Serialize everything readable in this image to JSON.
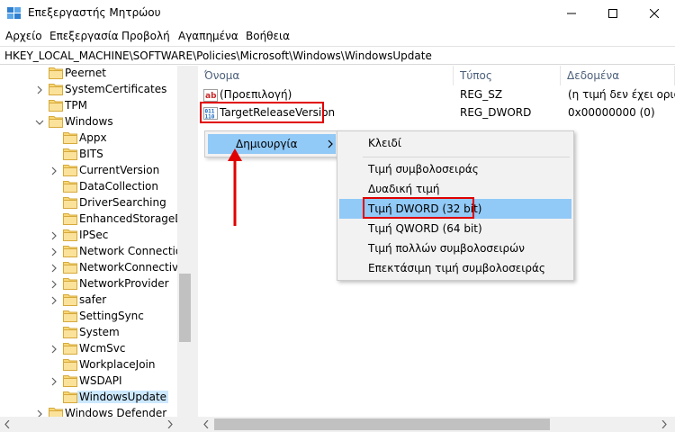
{
  "window": {
    "title": "Επεξεργαστής Μητρώου"
  },
  "menubar": [
    "Αρχείο",
    "Επεξεργασία",
    "Προβολή",
    "Αγαπημένα",
    "Βοήθεια"
  ],
  "address": "HKEY_LOCAL_MACHINE\\SOFTWARE\\Policies\\Microsoft\\Windows\\WindowsUpdate",
  "tree": {
    "items": [
      {
        "label": "Peernet",
        "expandable": false
      },
      {
        "label": "SystemCertificates",
        "expandable": true
      },
      {
        "label": "TPM",
        "expandable": false
      },
      {
        "label": "Windows",
        "expandable": true,
        "expanded": true
      },
      {
        "label": "Appx",
        "expandable": false
      },
      {
        "label": "BITS",
        "expandable": false
      },
      {
        "label": "CurrentVersion",
        "expandable": true
      },
      {
        "label": "DataCollection",
        "expandable": false
      },
      {
        "label": "DriverSearching",
        "expandable": false
      },
      {
        "label": "EnhancedStorageDe",
        "expandable": false
      },
      {
        "label": "IPSec",
        "expandable": true
      },
      {
        "label": "Network Connection",
        "expandable": true
      },
      {
        "label": "NetworkConnectivity",
        "expandable": true
      },
      {
        "label": "NetworkProvider",
        "expandable": true
      },
      {
        "label": "safer",
        "expandable": true
      },
      {
        "label": "SettingSync",
        "expandable": false
      },
      {
        "label": "System",
        "expandable": false
      },
      {
        "label": "WcmSvc",
        "expandable": true
      },
      {
        "label": "WorkplaceJoin",
        "expandable": false
      },
      {
        "label": "WSDAPI",
        "expandable": true
      },
      {
        "label": "WindowsUpdate",
        "expandable": false,
        "selected": true
      },
      {
        "label": "Windows Defender",
        "expandable": true
      }
    ]
  },
  "list": {
    "columns": [
      "Όνομα",
      "Τύπος",
      "Δεδομένα"
    ],
    "rows": [
      {
        "icon": "string-value-icon",
        "name": "(Προεπιλογή)",
        "type": "REG_SZ",
        "data": "(η τιμή δεν έχει οριστε"
      },
      {
        "icon": "dword-value-icon",
        "name": "TargetReleaseVersion",
        "type": "REG_DWORD",
        "data": "0x00000000 (0)"
      }
    ]
  },
  "context_menu": {
    "new_label": "Δημιουργία",
    "submenu": [
      {
        "label": "Κλειδί"
      },
      {
        "separator": true
      },
      {
        "label": "Τιμή συμβολοσειράς"
      },
      {
        "label": "Δυαδική τιμή"
      },
      {
        "label": "Τιμή DWORD (32 bit)",
        "active": true
      },
      {
        "label": "Τιμή QWORD (64 bit)"
      },
      {
        "label": "Τιμή πολλών συμβολοσειρών"
      },
      {
        "label": "Επεκτάσιμη τιμή συμβολοσειράς"
      }
    ]
  },
  "colors": {
    "accent_highlight": "#91c9f7",
    "annotation_red": "#e00000",
    "folder_yellow": "#f8d775"
  }
}
